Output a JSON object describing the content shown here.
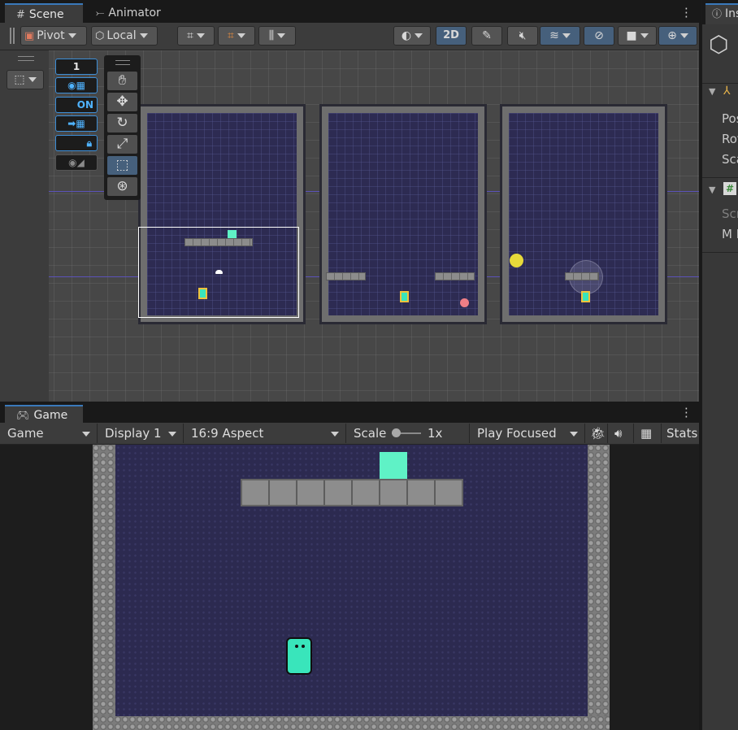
{
  "scene_tabs": {
    "scene_label": "Scene",
    "animator_label": "Animator"
  },
  "scene_toolbar": {
    "pivot_label": "Pivot",
    "local_label": "Local",
    "mode_2d_label": "2D"
  },
  "gizmo_overlay": {
    "layer_value": "1",
    "snap_on_label": "ON"
  },
  "game_tab": {
    "label": "Game"
  },
  "game_toolbar": {
    "view_label": "Game",
    "display_label": "Display 1",
    "aspect_label": "16:9 Aspect",
    "scale_label": "Scale",
    "scale_value": "1x",
    "play_mode_label": "Play Focused",
    "stats_label": "Stats"
  },
  "inspector": {
    "title": "Ins",
    "position_label": "Pos",
    "rotation_label": "Rot",
    "scale_label": "Sca",
    "script_label": "Scr",
    "field_label": "M F"
  },
  "colors": {
    "accent_blue": "#3a79bb",
    "room_fill": "#2d2b52",
    "player": "#39e5bb",
    "goal_block": "#5ff2c6",
    "coin": "#e6d93a",
    "enemy": "#ef7f86"
  }
}
